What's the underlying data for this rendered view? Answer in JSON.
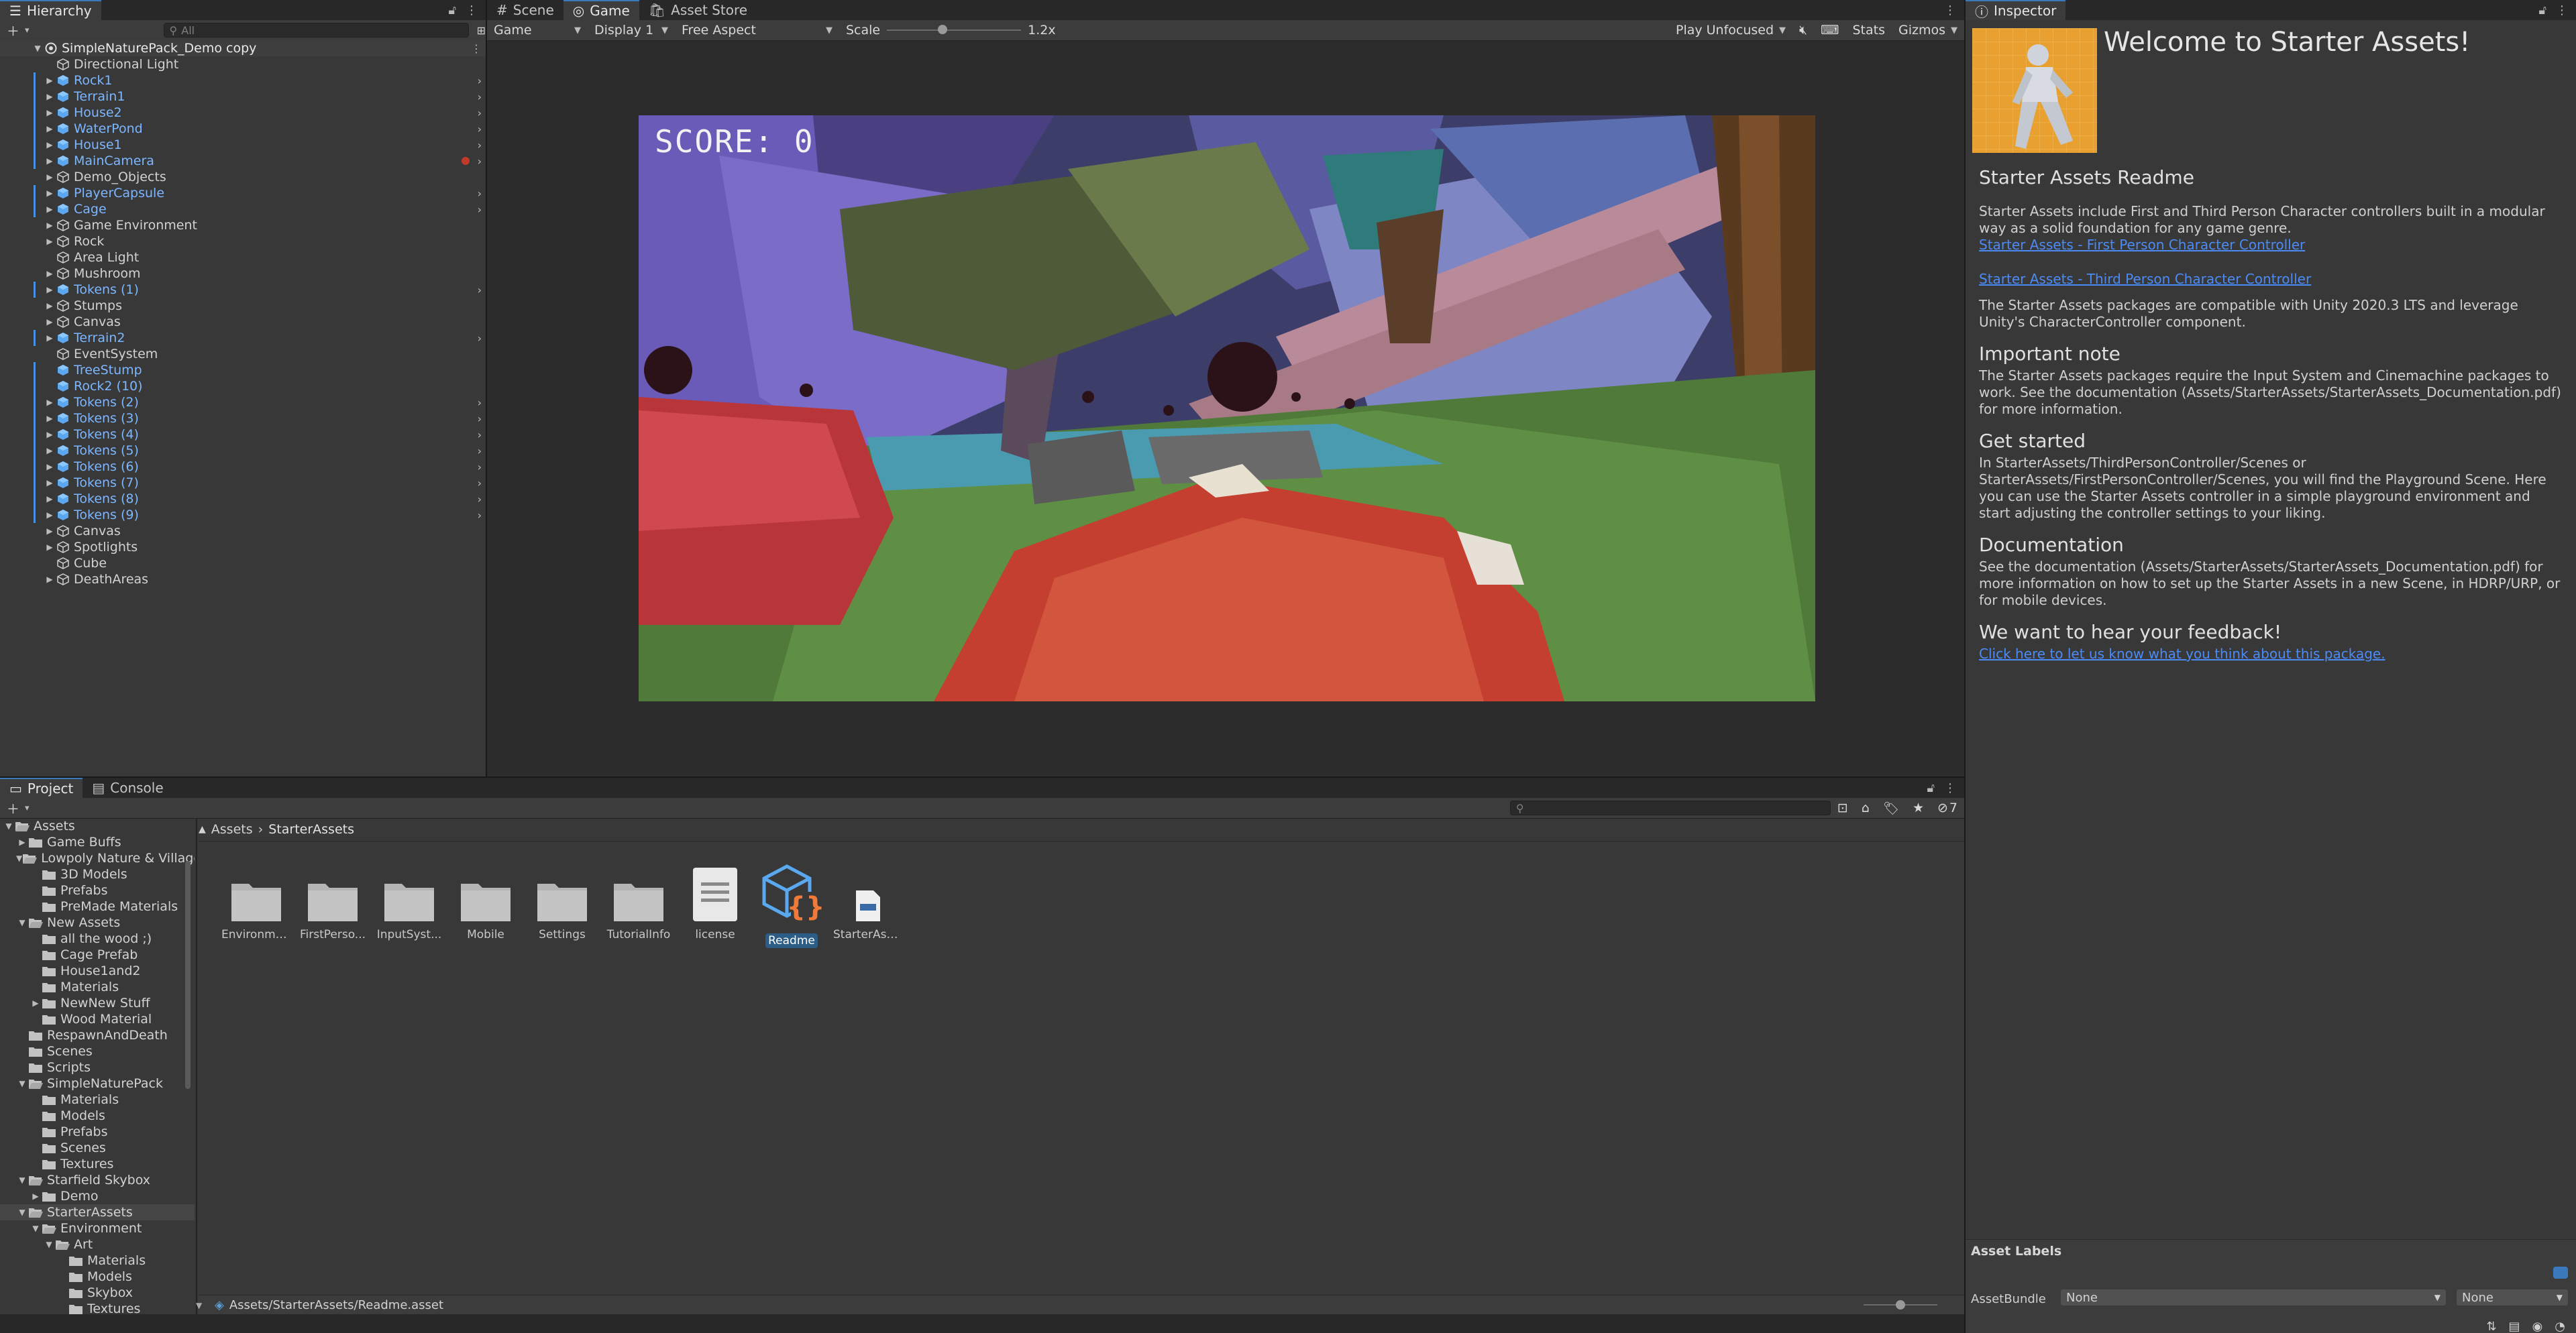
{
  "hierarchy": {
    "tab": "Hierarchy",
    "search_placeholder": "All",
    "root": "SimpleNaturePack_Demo copy",
    "items": [
      {
        "label": "Directional Light",
        "prefab": false,
        "expand": false
      },
      {
        "label": "Rock1",
        "prefab": true,
        "expand": true
      },
      {
        "label": "Terrain1",
        "prefab": true,
        "expand": true
      },
      {
        "label": "House2",
        "prefab": true,
        "expand": true
      },
      {
        "label": "WaterPond",
        "prefab": true,
        "expand": true
      },
      {
        "label": "House1",
        "prefab": true,
        "expand": true
      },
      {
        "label": "MainCamera",
        "prefab": true,
        "expand": true
      },
      {
        "label": "Demo_Objects",
        "prefab": false,
        "expand": true
      },
      {
        "label": "PlayerCapsule",
        "prefab": true,
        "expand": true
      },
      {
        "label": "Cage",
        "prefab": true,
        "expand": true
      },
      {
        "label": "Game Environment",
        "prefab": false,
        "expand": true
      },
      {
        "label": "Rock",
        "prefab": false,
        "expand": true
      },
      {
        "label": "Area Light",
        "prefab": false,
        "expand": false
      },
      {
        "label": "Mushroom",
        "prefab": false,
        "expand": true
      },
      {
        "label": "Tokens (1)",
        "prefab": true,
        "expand": true
      },
      {
        "label": "Stumps",
        "prefab": false,
        "expand": true
      },
      {
        "label": "Canvas",
        "prefab": false,
        "expand": true
      },
      {
        "label": "Terrain2",
        "prefab": true,
        "expand": true
      },
      {
        "label": "EventSystem",
        "prefab": false,
        "expand": false
      },
      {
        "label": "TreeStump",
        "prefab": true,
        "expand": false
      },
      {
        "label": "Rock2 (10)",
        "prefab": true,
        "expand": false
      },
      {
        "label": "Tokens (2)",
        "prefab": true,
        "expand": true
      },
      {
        "label": "Tokens (3)",
        "prefab": true,
        "expand": true
      },
      {
        "label": "Tokens (4)",
        "prefab": true,
        "expand": true
      },
      {
        "label": "Tokens (5)",
        "prefab": true,
        "expand": true
      },
      {
        "label": "Tokens (6)",
        "prefab": true,
        "expand": true
      },
      {
        "label": "Tokens (7)",
        "prefab": true,
        "expand": true
      },
      {
        "label": "Tokens (8)",
        "prefab": true,
        "expand": true
      },
      {
        "label": "Tokens (9)",
        "prefab": true,
        "expand": true
      },
      {
        "label": "Canvas",
        "prefab": false,
        "expand": true
      },
      {
        "label": "Spotlights",
        "prefab": false,
        "expand": true
      },
      {
        "label": "Cube",
        "prefab": false,
        "expand": false
      },
      {
        "label": "DeathAreas",
        "prefab": false,
        "expand": true
      }
    ]
  },
  "center": {
    "tabs": [
      "Scene",
      "Game",
      "Asset Store"
    ],
    "toolbar": {
      "mode": "Game",
      "display": "Display 1",
      "aspect": "Free Aspect",
      "scale_label": "Scale",
      "scale_value": "1.2x",
      "play": "Play Unfocused",
      "stats": "Stats",
      "gizmos": "Gizmos"
    },
    "score": "SCORE: 0"
  },
  "inspector": {
    "tab": "Inspector",
    "title": "Welcome to Starter Assets!",
    "section_title": "Starter Assets Readme",
    "intro": "Starter Assets include First and Third Person Character controllers built in a modular way as a solid foundation for any game genre.",
    "link1": "Starter Assets - First Person Character Controller",
    "link2": "Starter Assets - Third Person Character Controller",
    "compat": "The Starter Assets packages are compatible with Unity 2020.3 LTS and leverage Unity's CharacterController component.",
    "h_important": "Important note",
    "important": "The Starter Assets packages require the Input System and Cinemachine packages to work. See the documentation (Assets/StarterAssets/StarterAssets_Documentation.pdf) for more information.",
    "h_started": "Get started",
    "started": "In StarterAssets/ThirdPersonController/Scenes or StarterAssets/FirstPersonController/Scenes, you will find the Playground Scene. Here you can use the Starter Assets controller in a simple playground environment and start adjusting the controller settings to your liking.",
    "h_docs": "Documentation",
    "docs": "See the documentation (Assets/StarterAssets/StarterAssets_Documentation.pdf) for more information on how to set up the Starter Assets in a new Scene, in HDRP/URP, or for mobile devices.",
    "h_feedback": "We want to hear your feedback!",
    "feedback_link": "Click here to let us know what you think about this package.",
    "asset_labels": "Asset Labels",
    "assetbundle_label": "AssetBundle",
    "bundle_value": "None",
    "variant_value": "None"
  },
  "project": {
    "tabs": [
      "Project",
      "Console"
    ],
    "hidden_count": "7",
    "breadcrumb": [
      "Assets",
      "StarterAssets"
    ],
    "tree": [
      {
        "label": "Assets",
        "depth": 0,
        "arrow": "open",
        "folder": "open"
      },
      {
        "label": "Game Buffs",
        "depth": 1,
        "arrow": "closed",
        "folder": "closed"
      },
      {
        "label": "Lowpoly Nature & Village",
        "depth": 1,
        "arrow": "open",
        "folder": "open"
      },
      {
        "label": "3D Models",
        "depth": 2,
        "arrow": "none",
        "folder": "closed"
      },
      {
        "label": "Prefabs",
        "depth": 2,
        "arrow": "none",
        "folder": "closed"
      },
      {
        "label": "PreMade Materials",
        "depth": 2,
        "arrow": "none",
        "folder": "closed"
      },
      {
        "label": "New Assets",
        "depth": 1,
        "arrow": "open",
        "folder": "open"
      },
      {
        "label": "all the wood ;)",
        "depth": 2,
        "arrow": "none",
        "folder": "closed"
      },
      {
        "label": "Cage Prefab",
        "depth": 2,
        "arrow": "none",
        "folder": "closed"
      },
      {
        "label": "House1and2",
        "depth": 2,
        "arrow": "none",
        "folder": "closed"
      },
      {
        "label": "Materials",
        "depth": 2,
        "arrow": "none",
        "folder": "closed"
      },
      {
        "label": "NewNew Stuff",
        "depth": 2,
        "arrow": "closed",
        "folder": "closed"
      },
      {
        "label": "Wood Material",
        "depth": 2,
        "arrow": "none",
        "folder": "closed"
      },
      {
        "label": "RespawnAndDeath",
        "depth": 1,
        "arrow": "none",
        "folder": "closed"
      },
      {
        "label": "Scenes",
        "depth": 1,
        "arrow": "none",
        "folder": "closed"
      },
      {
        "label": "Scripts",
        "depth": 1,
        "arrow": "none",
        "folder": "closed"
      },
      {
        "label": "SimpleNaturePack",
        "depth": 1,
        "arrow": "open",
        "folder": "open"
      },
      {
        "label": "Materials",
        "depth": 2,
        "arrow": "none",
        "folder": "closed"
      },
      {
        "label": "Models",
        "depth": 2,
        "arrow": "none",
        "folder": "closed"
      },
      {
        "label": "Prefabs",
        "depth": 2,
        "arrow": "none",
        "folder": "closed"
      },
      {
        "label": "Scenes",
        "depth": 2,
        "arrow": "none",
        "folder": "closed"
      },
      {
        "label": "Textures",
        "depth": 2,
        "arrow": "none",
        "folder": "closed"
      },
      {
        "label": "Starfield Skybox",
        "depth": 1,
        "arrow": "open",
        "folder": "open"
      },
      {
        "label": "Demo",
        "depth": 2,
        "arrow": "closed",
        "folder": "closed"
      },
      {
        "label": "StarterAssets",
        "depth": 1,
        "arrow": "open",
        "folder": "open",
        "selected": true
      },
      {
        "label": "Environment",
        "depth": 2,
        "arrow": "open",
        "folder": "open"
      },
      {
        "label": "Art",
        "depth": 3,
        "arrow": "open",
        "folder": "open"
      },
      {
        "label": "Materials",
        "depth": 4,
        "arrow": "none",
        "folder": "closed"
      },
      {
        "label": "Models",
        "depth": 4,
        "arrow": "none",
        "folder": "closed"
      },
      {
        "label": "Skybox",
        "depth": 4,
        "arrow": "none",
        "folder": "closed"
      },
      {
        "label": "Textures",
        "depth": 4,
        "arrow": "none",
        "folder": "closed"
      }
    ],
    "assets": [
      {
        "label": "Environme...",
        "kind": "folder"
      },
      {
        "label": "FirstPerso...",
        "kind": "folder"
      },
      {
        "label": "InputSyst...",
        "kind": "folder"
      },
      {
        "label": "Mobile",
        "kind": "folder"
      },
      {
        "label": "Settings",
        "kind": "folder"
      },
      {
        "label": "TutorialInfo",
        "kind": "folder"
      },
      {
        "label": "license",
        "kind": "text"
      },
      {
        "label": "Readme",
        "kind": "readme",
        "selected": true
      },
      {
        "label": "StarterAss...",
        "kind": "doc"
      }
    ],
    "status_path": "Assets/StarterAssets/Readme.asset"
  }
}
